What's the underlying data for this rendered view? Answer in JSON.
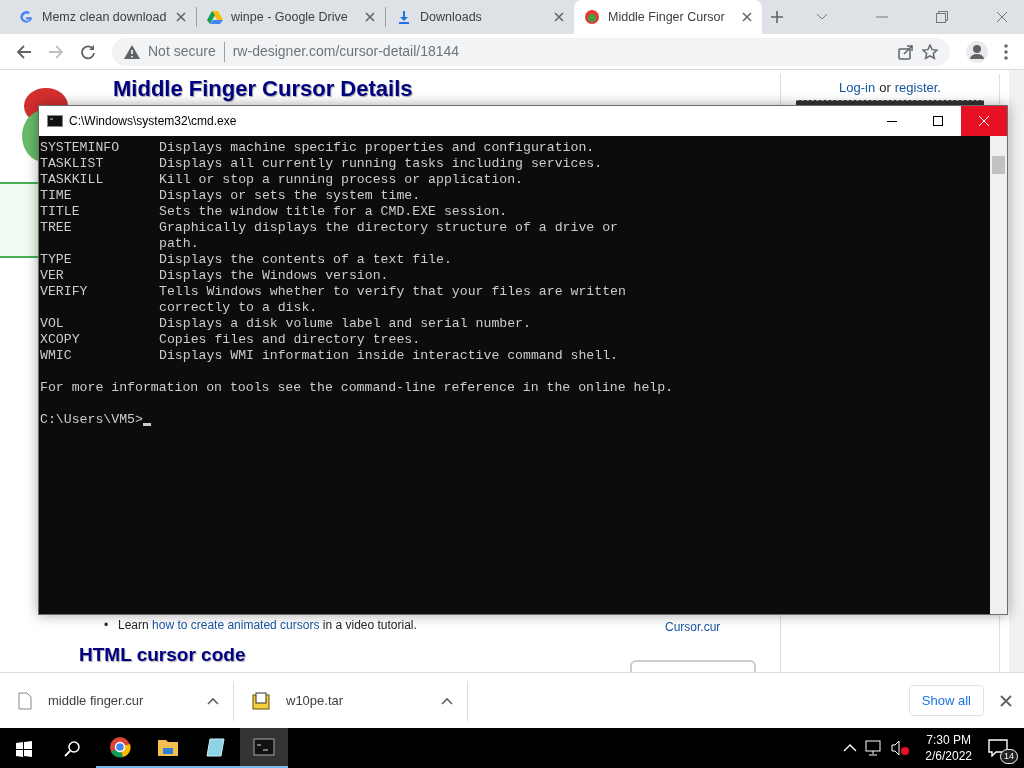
{
  "browser": {
    "tabs": [
      {
        "title": "Memz clean download",
        "kind": "google",
        "selected": false
      },
      {
        "title": "winpe - Google Drive",
        "kind": "drive",
        "selected": false
      },
      {
        "title": "Downloads",
        "kind": "download",
        "selected": false
      },
      {
        "title": "Middle Finger Cursor",
        "kind": "site",
        "selected": true
      }
    ],
    "address": {
      "security": "Not secure",
      "url": "rw-designer.com/cursor-detail/18144"
    }
  },
  "page": {
    "heading": "Middle Finger Cursor Details",
    "login": {
      "link1": "Log-in",
      "middle": "or",
      "link2": "register."
    },
    "tip": {
      "bullet": "•",
      "before": "Learn",
      "link": "how to create animated cursors",
      "after": "in a video tutorial."
    },
    "file_link": "Cursor.cur",
    "section_heading": "HTML cursor code"
  },
  "console": {
    "title": "C:\\Windows\\system32\\cmd.exe",
    "commands": [
      {
        "name": "SYSTEMINFO",
        "lines": [
          "Displays machine specific properties and configuration."
        ]
      },
      {
        "name": "TASKLIST",
        "lines": [
          "Displays all currently running tasks including services."
        ]
      },
      {
        "name": "TASKKILL",
        "lines": [
          "Kill or stop a running process or application."
        ]
      },
      {
        "name": "TIME",
        "lines": [
          "Displays or sets the system time."
        ]
      },
      {
        "name": "TITLE",
        "lines": [
          "Sets the window title for a CMD.EXE session."
        ]
      },
      {
        "name": "TREE",
        "lines": [
          "Graphically displays the directory structure of a drive or",
          "path."
        ]
      },
      {
        "name": "TYPE",
        "lines": [
          "Displays the contents of a text file."
        ]
      },
      {
        "name": "VER",
        "lines": [
          "Displays the Windows version."
        ]
      },
      {
        "name": "VERIFY",
        "lines": [
          "Tells Windows whether to verify that your files are written",
          "correctly to a disk."
        ]
      },
      {
        "name": "VOL",
        "lines": [
          "Displays a disk volume label and serial number."
        ]
      },
      {
        "name": "XCOPY",
        "lines": [
          "Copies files and directory trees."
        ]
      },
      {
        "name": "WMIC",
        "lines": [
          "Displays WMI information inside interactive command shell."
        ]
      }
    ],
    "footer": "For more information on tools see the command-line reference in the online help.",
    "prompt": "C:\\Users\\VM5>"
  },
  "downloads": {
    "items": [
      {
        "name": "middle finger.cur",
        "kind": "file"
      },
      {
        "name": "w10pe.tar",
        "kind": "archive"
      }
    ],
    "show_all": "Show all"
  },
  "taskbar": {
    "apps": [
      {
        "kind": "chrome",
        "selected": false
      },
      {
        "kind": "explorer",
        "selected": false
      },
      {
        "kind": "notepad",
        "selected": false
      },
      {
        "kind": "console",
        "selected": true
      }
    ],
    "time": "7:30 PM",
    "date": "2/6/2022",
    "notifications": "14"
  }
}
